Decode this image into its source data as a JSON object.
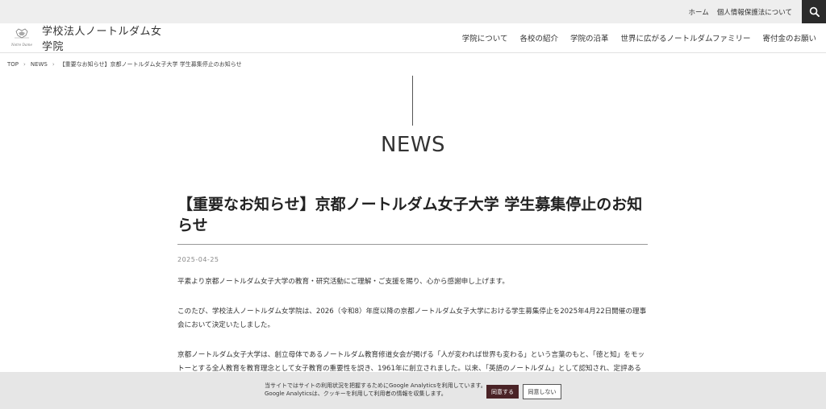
{
  "topbar": {
    "links": [
      "ホーム",
      "個人情報保護法について"
    ]
  },
  "header": {
    "logo_text": "学校法人ノートルダム女学院",
    "logo_subtext": "Notre Dame",
    "nav": [
      "学院について",
      "各校の紹介",
      "学院の沿革",
      "世界に広がるノートルダムファミリー",
      "寄付金のお願い"
    ]
  },
  "breadcrumb": [
    "TOP",
    "NEWS",
    "【重要なお知らせ】京都ノートルダム女子大学 学生募集停止のお知らせ"
  ],
  "section": {
    "title": "NEWS"
  },
  "article": {
    "title": "【重要なお知らせ】京都ノートルダム女子大学 学生募集停止のお知らせ",
    "date": "2025-04-25",
    "paragraphs": [
      "平素より京都ノートルダム女子大学の教育・研究活動にご理解・ご支援を賜り、心から感謝申し上げます。",
      "このたび、学校法人ノートルダム女学院は、2026（令和8）年度以降の京都ノートルダム女子大学における学生募集停止を2025年4月22日開催の理事会において決定いたしました。",
      "京都ノートルダム女子大学は、創立母体であるノートルダム教育修道女会が掲げる「人が変われば世界も変わる」という言葉のもと、「徳と知」をモットーとする全人教育を教育理念として女子教育の重要性を説き、1961年に創立されました。以来、「英語のノートルダム」として認知され、定評ある英語"
    ]
  },
  "cookie": {
    "line1": "当サイトではサイトの利用状況を把握するためにGoogle Analyticsを利用しています。",
    "line2": "Google Analyticsは、クッキーを利用して利用者の情報を収集します。",
    "agree": "同意する",
    "disagree": "同意しない"
  },
  "colors": {
    "accent": "#4a2326",
    "topbar_bg": "#eeeeee",
    "search_bg": "#2b2b2b",
    "cookie_bg": "#e6e6e6"
  },
  "icons": {
    "search": "search-icon",
    "logo": "crest-icon",
    "chevron": "chevron-right-icon"
  }
}
